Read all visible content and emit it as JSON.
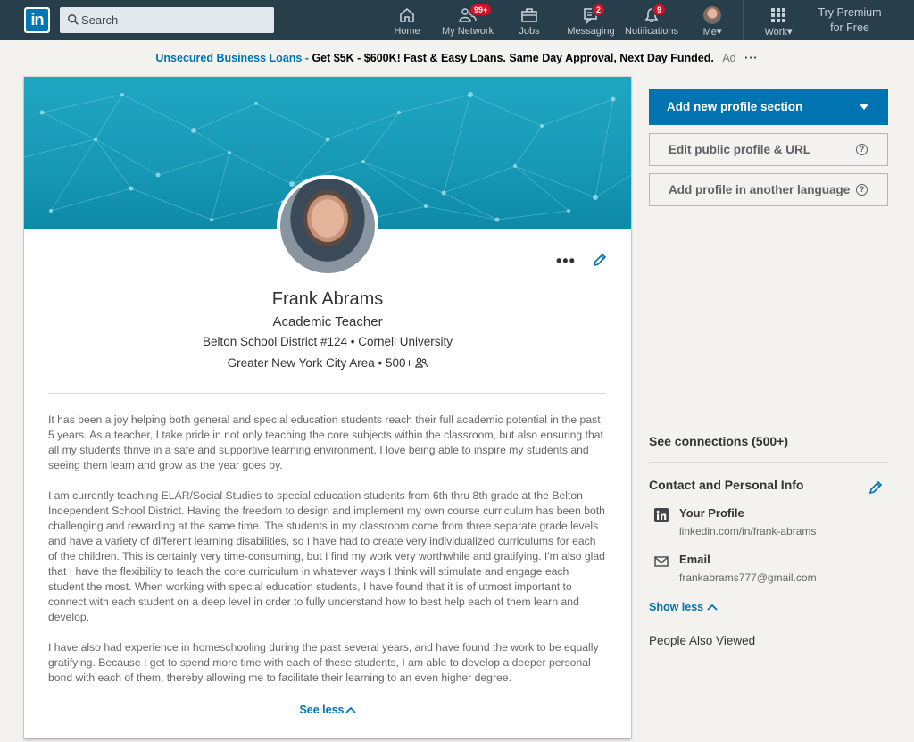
{
  "nav": {
    "logo": "in",
    "search_placeholder": "Search",
    "items": [
      {
        "label": "Home",
        "icon": "home-icon",
        "badge": ""
      },
      {
        "label": "My Network",
        "icon": "network-icon",
        "badge": "99+"
      },
      {
        "label": "Jobs",
        "icon": "jobs-icon",
        "badge": ""
      },
      {
        "label": "Messaging",
        "icon": "messaging-icon",
        "badge": "2"
      },
      {
        "label": "Notifications",
        "icon": "bell-icon",
        "badge": "9"
      },
      {
        "label": "Me",
        "icon": "avatar",
        "badge": ""
      },
      {
        "label": "Work",
        "icon": "grid-icon",
        "badge": ""
      }
    ],
    "premium_line1": "Try Premium",
    "premium_line2": "for Free",
    "bg_color": "#283e4a",
    "badge_color": "#d11124"
  },
  "ad": {
    "link_text": "Unsecured Business Loans -",
    "text": "Get $5K - $600K! Fast & Easy Loans. Same Day Approval, Next Day Funded.",
    "tag": "Ad",
    "more": "···"
  },
  "profile": {
    "name": "Frank Abrams",
    "headline": "Academic Teacher",
    "education_line": "Belton School District #124 • Cornell University",
    "location_line": "Greater New York City Area • 500+",
    "more_actions": "•••",
    "summary": [
      "It has been a joy helping both general and special education students reach their full academic potential in the past 5 years. As a teacher, I take pride in not only teaching the core subjects within the classroom, but also ensuring that all my students thrive in a safe and supportive learning environment. I love being able to inspire my students and seeing them learn and grow as the year goes by.",
      "I am currently teaching ELAR/Social Studies to special education students from 6th thru 8th grade at the Belton Independent School District. Having the freedom to design and implement my own course curriculum has been both challenging and rewarding at the same time. The students in my classroom come from three separate grade levels and have a variety of different learning disabilities, so I have had to create very individualized curriculums for each of the children. This is certainly very time-consuming, but I find my work very worthwhile and gratifying. I'm also glad that I have the flexibility to teach the core curriculum in whatever ways I think will stimulate and engage each student the most. When working with special education students, I have found that it is of utmost important to connect with each student on a deep level in order to fully understand how to best help each of them learn and develop.",
      "I have also had experience in homeschooling during the past several years, and have found the work to be equally gratifying. Because I get to spend more time with each of these students, I am able to develop a deeper personal bond with each of them, thereby allowing me to facilitate their learning to an even higher degree."
    ],
    "see_less": "See less"
  },
  "rail": {
    "add_section": "Add new profile section",
    "edit_public": "Edit public profile & URL",
    "add_language": "Add profile in another language",
    "help_glyph": "?",
    "see_connections": "See connections (500+)",
    "contact_header": "Contact and Personal Info",
    "contact_items": [
      {
        "title": "Your Profile",
        "value": "linkedin.com/in/frank-abrams",
        "icon": "linkedin-icon"
      },
      {
        "title": "Email",
        "value": "frankabrams777@gmail.com",
        "icon": "envelope-icon"
      }
    ],
    "show_less": "Show less",
    "people_also_viewed": "People Also Viewed",
    "accent_color": "#0073b1"
  }
}
